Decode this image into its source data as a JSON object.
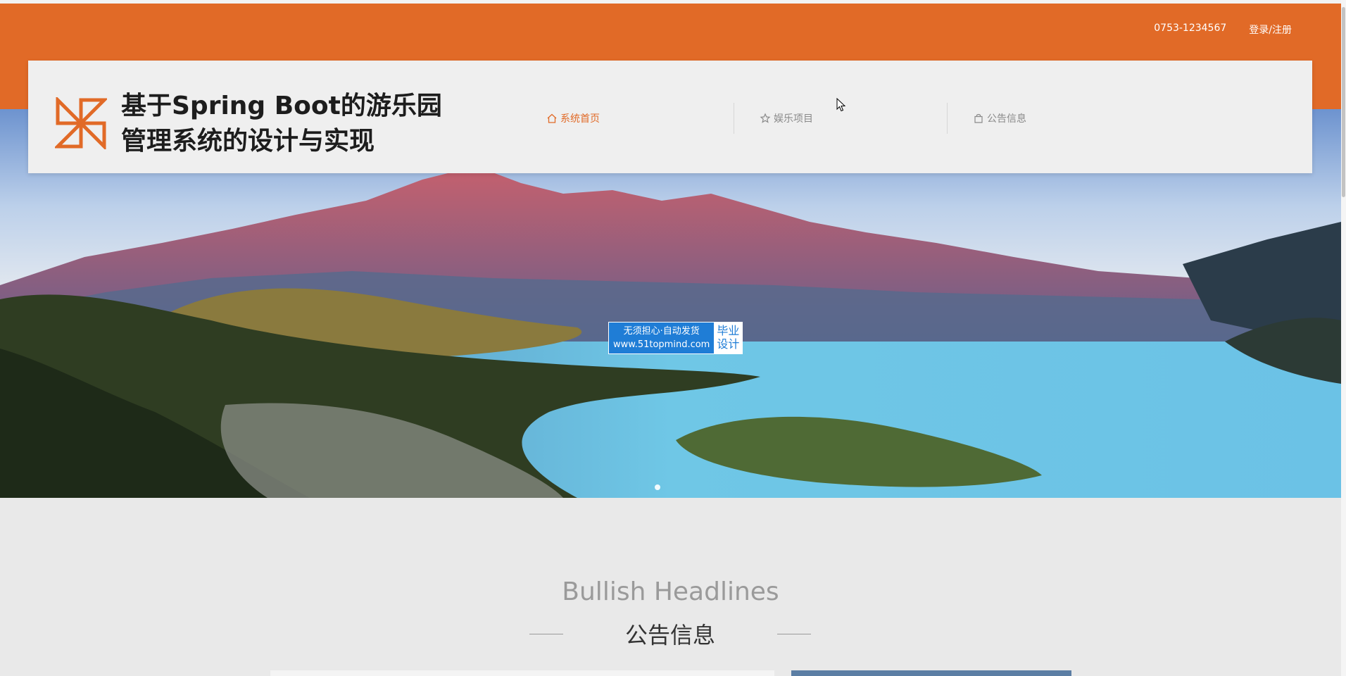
{
  "topbar": {
    "phone": "0753-1234567",
    "login_label": "登录/注册"
  },
  "site": {
    "title_line1": "基于Spring Boot的游乐园",
    "title_line2": "管理系统的设计与实现"
  },
  "nav": {
    "items": [
      {
        "label": "系统首页",
        "icon": "home-icon",
        "active": true
      },
      {
        "label": "娱乐项目",
        "icon": "star-icon",
        "active": false
      },
      {
        "label": "公告信息",
        "icon": "bag-icon",
        "active": false
      }
    ]
  },
  "watermark": {
    "line1": "无须担心·自动发货",
    "line2": "www.51topmind.com",
    "right_line1": "毕业",
    "right_line2": "设计"
  },
  "section": {
    "title_en": "Bullish Headlines",
    "title_cn": "公告信息"
  },
  "colors": {
    "accent": "#e16a27",
    "nav_inactive": "#8a8a8a",
    "watermark_blue": "#1f7dd6"
  }
}
